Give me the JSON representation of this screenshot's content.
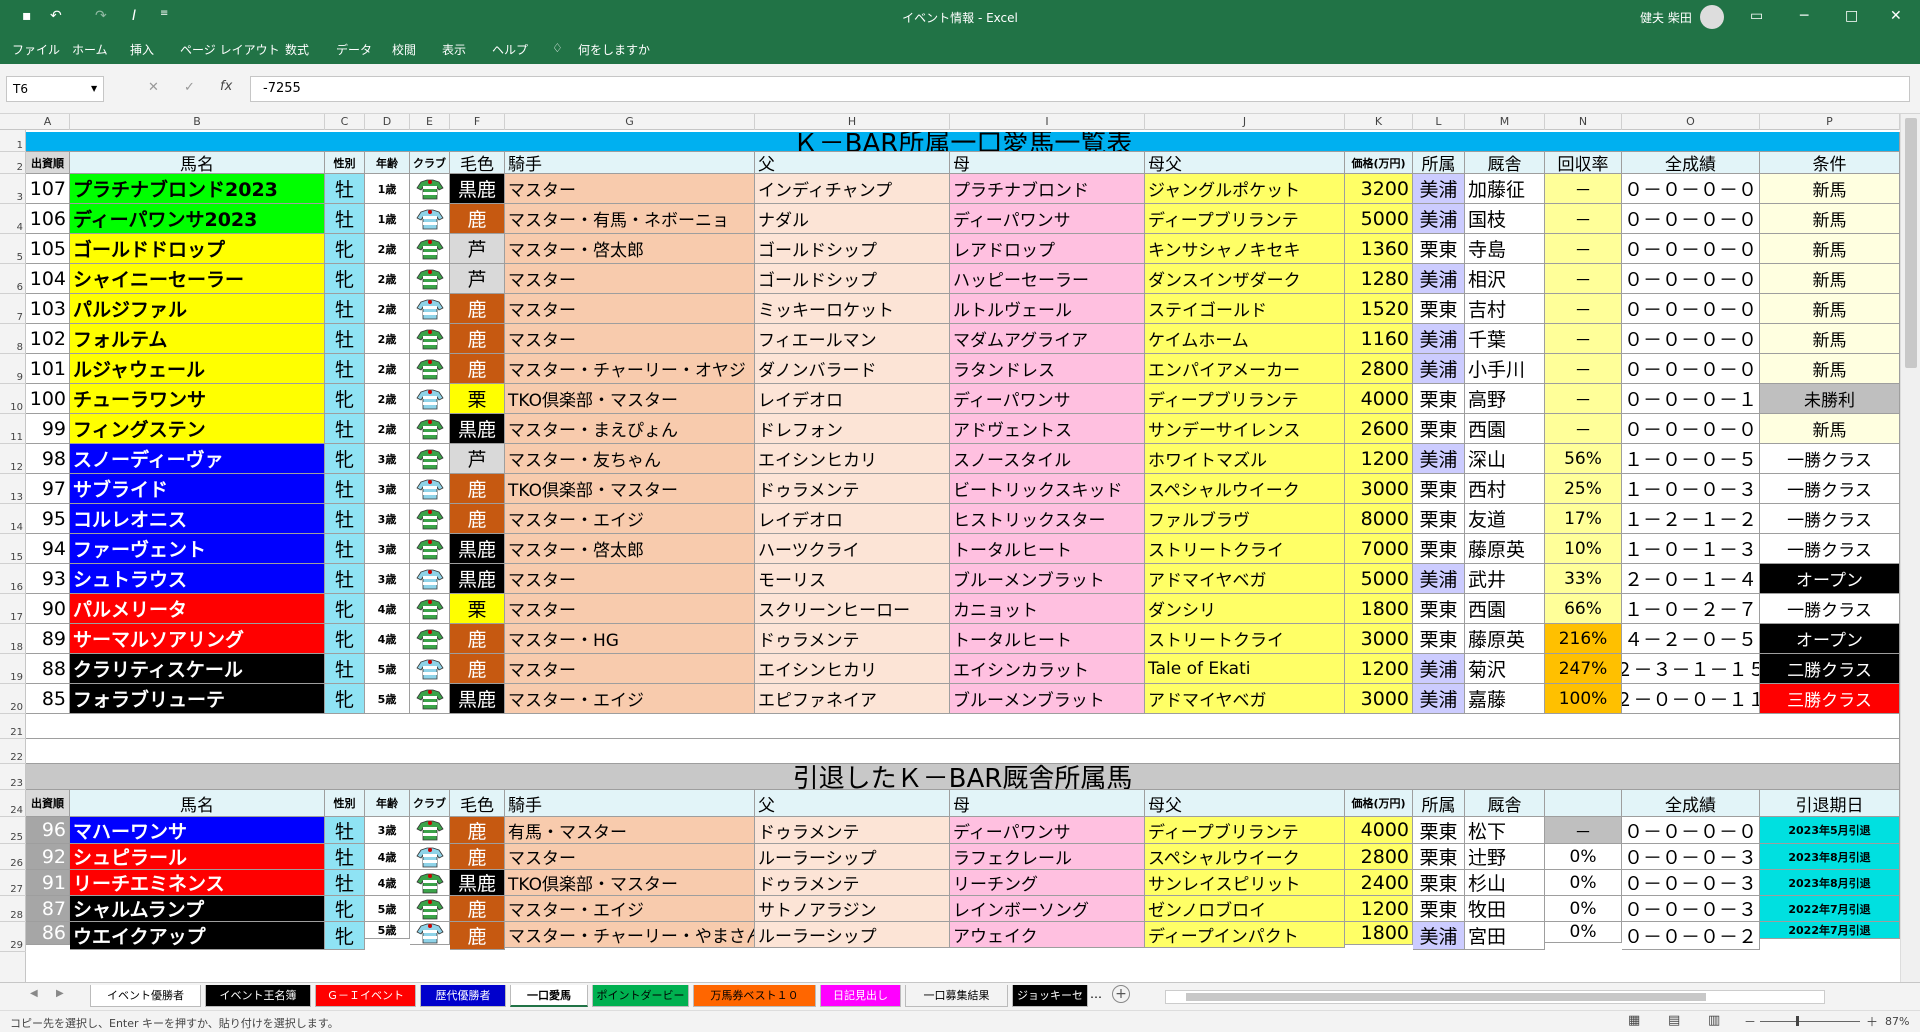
{
  "window": {
    "title": "イベント情報 - Excel",
    "user": "健夫 柴田"
  },
  "ribbon_tabs": [
    "ファイル",
    "ホーム",
    "挿入",
    "ページ レイアウト",
    "数式",
    "データ",
    "校閲",
    "表示",
    "ヘルプ",
    "何をしますか"
  ],
  "formula_bar": {
    "name_box": "T6",
    "formula": "-7255",
    "fx": "fx"
  },
  "columns": [
    "A",
    "B",
    "C",
    "D",
    "E",
    "F",
    "G",
    "H",
    "I",
    "J",
    "K",
    "L",
    "M",
    "N",
    "O",
    "P"
  ],
  "rows": [
    "1",
    "2",
    "3",
    "4",
    "5",
    "6",
    "7",
    "8",
    "9",
    "10",
    "11",
    "12",
    "13",
    "14",
    "15",
    "16",
    "17",
    "18",
    "19",
    "20",
    "21",
    "22",
    "23",
    "24",
    "25",
    "26",
    "27",
    "28",
    "29"
  ],
  "section1": {
    "title": "Ｋ－BAR所属一口愛馬一覧表",
    "headers": [
      "出資順",
      "馬名",
      "性別",
      "年齢",
      "クラブ",
      "毛色",
      "騎手",
      "父",
      "母",
      "母父",
      "価格(万円)",
      "所属",
      "厩舎",
      "回収率",
      "全成績",
      "条件"
    ],
    "rows": [
      {
        "no": "107",
        "name": "プラチナブロンド2023",
        "sex": "牡",
        "age": "1歳",
        "color": "黒鹿",
        "jockey": "マスター",
        "sire": "インディチャンプ",
        "dam": "プラチナブロンド",
        "damsire": "ジャングルポケット",
        "price": "3200",
        "belong": "美浦",
        "trainer": "加藤征",
        "rate": "－",
        "record": "０－０－０－０",
        "cond": "新馬"
      },
      {
        "no": "106",
        "name": "ディーパワンサ2023",
        "sex": "牡",
        "age": "1歳",
        "color": "鹿",
        "jockey": "マスター・有馬・ネボーニョ",
        "sire": "ナダル",
        "dam": "ディーパワンサ",
        "damsire": "ディープブリランテ",
        "price": "5000",
        "belong": "美浦",
        "trainer": "国枝",
        "rate": "－",
        "record": "０－０－０－０",
        "cond": "新馬"
      },
      {
        "no": "105",
        "name": "ゴールドドロップ",
        "sex": "牝",
        "age": "2歳",
        "color": "芦",
        "jockey": "マスター・啓太郎",
        "sire": "ゴールドシップ",
        "dam": "レアドロップ",
        "damsire": "キンサシャノキセキ",
        "price": "1360",
        "belong": "栗東",
        "trainer": "寺島",
        "rate": "－",
        "record": "０－０－０－０",
        "cond": "新馬"
      },
      {
        "no": "104",
        "name": "シャイニーセーラー",
        "sex": "牝",
        "age": "2歳",
        "color": "芦",
        "jockey": "マスター",
        "sire": "ゴールドシップ",
        "dam": "ハッピーセーラー",
        "damsire": "ダンスインザダーク",
        "price": "1280",
        "belong": "美浦",
        "trainer": "相沢",
        "rate": "－",
        "record": "０－０－０－０",
        "cond": "新馬"
      },
      {
        "no": "103",
        "name": "パルジファル",
        "sex": "牡",
        "age": "2歳",
        "color": "鹿",
        "jockey": "マスター",
        "sire": "ミッキーロケット",
        "dam": "ルトルヴェール",
        "damsire": "ステイゴールド",
        "price": "1520",
        "belong": "栗東",
        "trainer": "吉村",
        "rate": "－",
        "record": "０－０－０－０",
        "cond": "新馬"
      },
      {
        "no": "102",
        "name": "フォルテム",
        "sex": "牡",
        "age": "2歳",
        "color": "鹿",
        "jockey": "マスター",
        "sire": "フィエールマン",
        "dam": "マダムアグライア",
        "damsire": "ケイムホーム",
        "price": "1160",
        "belong": "美浦",
        "trainer": "千葉",
        "rate": "－",
        "record": "０－０－０－０",
        "cond": "新馬"
      },
      {
        "no": "101",
        "name": "ルジャウェール",
        "sex": "牡",
        "age": "2歳",
        "color": "鹿",
        "jockey": "マスター・チャーリー・オヤジ",
        "sire": "ダノンバラード",
        "dam": "ラタンドレス",
        "damsire": "エンパイアメーカー",
        "price": "2800",
        "belong": "美浦",
        "trainer": "小手川",
        "rate": "－",
        "record": "０－０－０－０",
        "cond": "新馬"
      },
      {
        "no": "100",
        "name": "チューラワンサ",
        "sex": "牝",
        "age": "2歳",
        "color": "栗",
        "jockey": "TKO倶楽部・マスター",
        "sire": "レイデオロ",
        "dam": "ディーパワンサ",
        "damsire": "ディープブリランテ",
        "price": "4000",
        "belong": "栗東",
        "trainer": "高野",
        "rate": "－",
        "record": "０－０－０－１",
        "cond": "未勝利"
      },
      {
        "no": "99",
        "name": "フィングステン",
        "sex": "牡",
        "age": "2歳",
        "color": "黒鹿",
        "jockey": "マスター・まえぴょん",
        "sire": "ドレフォン",
        "dam": "アドヴェントス",
        "damsire": "サンデーサイレンス",
        "price": "2600",
        "belong": "栗東",
        "trainer": "西園",
        "rate": "－",
        "record": "０－０－０－０",
        "cond": "新馬"
      },
      {
        "no": "98",
        "name": "スノーディーヴァ",
        "sex": "牝",
        "age": "3歳",
        "color": "芦",
        "jockey": "マスター・友ちゃん",
        "sire": "エイシンヒカリ",
        "dam": "スノースタイル",
        "damsire": "ホワイトマズル",
        "price": "1200",
        "belong": "美浦",
        "trainer": "深山",
        "rate": "56%",
        "record": "１－０－０－５",
        "cond": "一勝クラス"
      },
      {
        "no": "97",
        "name": "サブライド",
        "sex": "牡",
        "age": "3歳",
        "color": "鹿",
        "jockey": "TKO倶楽部・マスター",
        "sire": "ドゥラメンテ",
        "dam": "ビートリックスキッド",
        "damsire": "スペシャルウイーク",
        "price": "3000",
        "belong": "栗東",
        "trainer": "西村",
        "rate": "25%",
        "record": "１－０－０－３",
        "cond": "一勝クラス"
      },
      {
        "no": "95",
        "name": "コルレオニス",
        "sex": "牡",
        "age": "3歳",
        "color": "鹿",
        "jockey": "マスター・エイジ",
        "sire": "レイデオロ",
        "dam": "ヒストリックスター",
        "damsire": "ファルブラヴ",
        "price": "8000",
        "belong": "栗東",
        "trainer": "友道",
        "rate": "17%",
        "record": "１－２－１－２",
        "cond": "一勝クラス"
      },
      {
        "no": "94",
        "name": "ファーヴェント",
        "sex": "牡",
        "age": "3歳",
        "color": "黒鹿",
        "jockey": "マスター・啓太郎",
        "sire": "ハーツクライ",
        "dam": "トータルヒート",
        "damsire": "ストリートクライ",
        "price": "7000",
        "belong": "栗東",
        "trainer": "藤原英",
        "rate": "10%",
        "record": "１－０－１－３",
        "cond": "一勝クラス"
      },
      {
        "no": "93",
        "name": "シュトラウス",
        "sex": "牡",
        "age": "3歳",
        "color": "黒鹿",
        "jockey": "マスター",
        "sire": "モーリス",
        "dam": "ブルーメンブラット",
        "damsire": "アドマイヤベガ",
        "price": "5000",
        "belong": "美浦",
        "trainer": "武井",
        "rate": "33%",
        "record": "２－０－１－４",
        "cond": "オープン"
      },
      {
        "no": "90",
        "name": "パルメリータ",
        "sex": "牝",
        "age": "4歳",
        "color": "栗",
        "jockey": "マスター",
        "sire": "スクリーンヒーロー",
        "dam": "カニョット",
        "damsire": "ダンシリ",
        "price": "1800",
        "belong": "栗東",
        "trainer": "西園",
        "rate": "66%",
        "record": "１－０－２－７",
        "cond": "一勝クラス"
      },
      {
        "no": "89",
        "name": "サーマルソアリング",
        "sex": "牝",
        "age": "4歳",
        "color": "鹿",
        "jockey": "マスター・HG",
        "sire": "ドゥラメンテ",
        "dam": "トータルヒート",
        "damsire": "ストリートクライ",
        "price": "3000",
        "belong": "栗東",
        "trainer": "藤原英",
        "rate": "216%",
        "record": "４－２－０－５",
        "cond": "オープン"
      },
      {
        "no": "88",
        "name": "クラリティスケール",
        "sex": "牡",
        "age": "5歳",
        "color": "鹿",
        "jockey": "マスター",
        "sire": "エイシンヒカリ",
        "dam": "エイシンカラット",
        "damsire": "Tale of Ekati",
        "price": "1200",
        "belong": "美浦",
        "trainer": "菊沢",
        "rate": "247%",
        "record": "２－３－１－１５",
        "cond": "二勝クラス"
      },
      {
        "no": "85",
        "name": "フォラブリューテ",
        "sex": "牝",
        "age": "5歳",
        "color": "黒鹿",
        "jockey": "マスター・エイジ",
        "sire": "エピファネイア",
        "dam": "ブルーメンブラット",
        "damsire": "アドマイヤベガ",
        "price": "3000",
        "belong": "美浦",
        "trainer": "嘉藤",
        "rate": "100%",
        "record": "２－０－０－１１",
        "cond": "三勝クラス"
      }
    ]
  },
  "section2": {
    "title": "引退したＫ－BAR厩舎所属馬",
    "headers": [
      "出資順",
      "馬名",
      "性別",
      "年齢",
      "クラブ",
      "毛色",
      "騎手",
      "父",
      "母",
      "母父",
      "価格(万円)",
      "所属",
      "厩舎",
      "",
      "全成績",
      "引退期日"
    ],
    "rows": [
      {
        "no": "96",
        "name": "マハーワンサ",
        "sex": "牡",
        "age": "3歳",
        "color": "鹿",
        "jockey": "有馬・マスター",
        "sire": "ドゥラメンテ",
        "dam": "ディーパワンサ",
        "damsire": "ディープブリランテ",
        "price": "4000",
        "belong": "栗東",
        "trainer": "松下",
        "rate": "－",
        "record": "０－０－０－０",
        "cond": "2023年5月引退"
      },
      {
        "no": "92",
        "name": "シュピラール",
        "sex": "牡",
        "age": "4歳",
        "color": "鹿",
        "jockey": "マスター",
        "sire": "ルーラーシップ",
        "dam": "ラフェクレール",
        "damsire": "スペシャルウイーク",
        "price": "2800",
        "belong": "栗東",
        "trainer": "辻野",
        "rate": "0%",
        "record": "０－０－０－３",
        "cond": "2023年8月引退"
      },
      {
        "no": "91",
        "name": "リーチエミネンス",
        "sex": "牡",
        "age": "4歳",
        "color": "黒鹿",
        "jockey": "TKO倶楽部・マスター",
        "sire": "ドゥラメンテ",
        "dam": "リーチング",
        "damsire": "サンレイスピリット",
        "price": "2400",
        "belong": "栗東",
        "trainer": "杉山",
        "rate": "0%",
        "record": "０－０－０－３",
        "cond": "2023年8月引退"
      },
      {
        "no": "87",
        "name": "シャルムランプ",
        "sex": "牝",
        "age": "5歳",
        "color": "鹿",
        "jockey": "マスター・エイジ",
        "sire": "サトノアラジン",
        "dam": "レインボーソング",
        "damsire": "ゼンノロブロイ",
        "price": "1200",
        "belong": "栗東",
        "trainer": "牧田",
        "rate": "0%",
        "record": "０－０－０－３",
        "cond": "2022年7月引退"
      },
      {
        "no": "86",
        "name": "ウエイクアップ",
        "sex": "牝",
        "age": "5歳",
        "color": "鹿",
        "jockey": "マスター・チャーリー・やまさん",
        "sire": "ルーラーシップ",
        "dam": "アウェイク",
        "damsire": "ディープインパクト",
        "price": "1800",
        "belong": "美浦",
        "trainer": "宮田",
        "rate": "0%",
        "record": "０－０－０－２",
        "cond": "2022年7月引退"
      }
    ]
  },
  "sheet_tabs": [
    {
      "label": "イベント優勝者",
      "bg": "#ffffff",
      "fg": "#000000"
    },
    {
      "label": "イベント王名簿",
      "bg": "#000000",
      "fg": "#ffffff"
    },
    {
      "label": "Ｇ－Ｉイベント",
      "bg": "#ff0000",
      "fg": "#ffffff"
    },
    {
      "label": "歴代優勝者",
      "bg": "#0000cc",
      "fg": "#ffffff"
    },
    {
      "label": "一口愛馬",
      "bg": "#ffffff",
      "fg": "#000000"
    },
    {
      "label": "ポイントダービー",
      "bg": "#00b050",
      "fg": "#000000"
    },
    {
      "label": "万馬券ベスト１０",
      "bg": "#ff6600",
      "fg": "#000000"
    },
    {
      "label": "日記見出し",
      "bg": "#ff00ff",
      "fg": "#ffffff"
    },
    {
      "label": "一口募集結果",
      "bg": "#f3f3f3",
      "fg": "#000000"
    },
    {
      "label": "ジョッキーセ",
      "bg": "#000000",
      "fg": "#ffffff"
    }
  ],
  "status": {
    "message": "コピー先を選択し、Enter キーを押すか、貼り付けを選択します。",
    "zoom": "87%"
  },
  "colors": {
    "excel_green": "#217346",
    "title_bg": "#00b0f0",
    "name_green": "#00ff00",
    "name_yellow": "#ffff00",
    "name_blue": "#0000ff",
    "name_red": "#ff0000",
    "name_black": "#000000"
  },
  "icons": [
    "save-icon",
    "undo-icon",
    "redo-icon",
    "italic-icon",
    "customize-icon",
    "user-icon",
    "ribbon-display-icon",
    "minimize-icon",
    "maximize-icon",
    "close-icon",
    "lightbulb-icon",
    "cancel-icon",
    "enter-icon",
    "function-icon",
    "add-sheet-icon",
    "normal-view-icon",
    "page-layout-icon",
    "page-break-icon"
  ]
}
